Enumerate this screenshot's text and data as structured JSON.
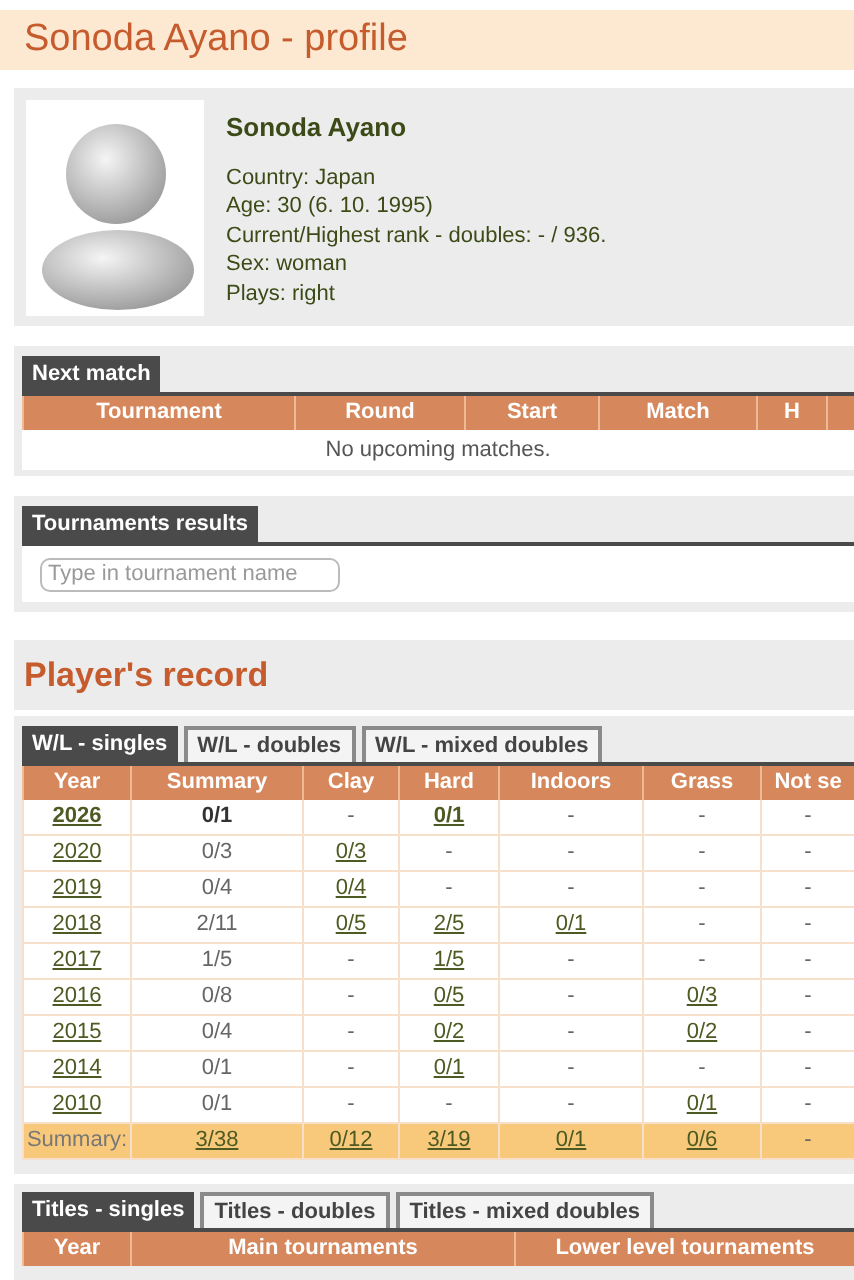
{
  "page_title": "Sonoda Ayano - profile",
  "profile": {
    "name": "Sonoda Ayano",
    "details": [
      "Country: Japan",
      "Age: 30 (6. 10. 1995)",
      "Current/Highest rank - doubles: - / 936.",
      "Sex: woman",
      "Plays: right"
    ]
  },
  "next_match": {
    "tab": "Next match",
    "columns": [
      "Tournament",
      "Round",
      "Start",
      "Match",
      "H"
    ],
    "empty_message": "No upcoming matches."
  },
  "tournament_results": {
    "tab": "Tournaments results",
    "search": {
      "placeholder": "Type in tournament name"
    }
  },
  "record_heading": "Player's record",
  "record": {
    "tabs": [
      {
        "label": "W/L - singles",
        "selected": true
      },
      {
        "label": "W/L - doubles",
        "selected": false
      },
      {
        "label": "W/L - mixed doubles",
        "selected": false
      }
    ],
    "columns": [
      "Year",
      "Summary",
      "Clay",
      "Hard",
      "Indoors",
      "Grass",
      "Not se"
    ],
    "rows": [
      {
        "current": true,
        "cells": [
          {
            "text": "2026",
            "link": true
          },
          {
            "text": "0/1",
            "link": false
          },
          {
            "text": "-",
            "link": false
          },
          {
            "text": "0/1",
            "link": true
          },
          {
            "text": "-",
            "link": false
          },
          {
            "text": "-",
            "link": false
          },
          {
            "text": "-",
            "link": false
          }
        ]
      },
      {
        "current": false,
        "cells": [
          {
            "text": "2020",
            "link": true
          },
          {
            "text": "0/3",
            "link": false
          },
          {
            "text": "0/3",
            "link": true
          },
          {
            "text": "-",
            "link": false
          },
          {
            "text": "-",
            "link": false
          },
          {
            "text": "-",
            "link": false
          },
          {
            "text": "-",
            "link": false
          }
        ]
      },
      {
        "current": false,
        "cells": [
          {
            "text": "2019",
            "link": true
          },
          {
            "text": "0/4",
            "link": false
          },
          {
            "text": "0/4",
            "link": true
          },
          {
            "text": "-",
            "link": false
          },
          {
            "text": "-",
            "link": false
          },
          {
            "text": "-",
            "link": false
          },
          {
            "text": "-",
            "link": false
          }
        ]
      },
      {
        "current": false,
        "cells": [
          {
            "text": "2018",
            "link": true
          },
          {
            "text": "2/11",
            "link": false
          },
          {
            "text": "0/5",
            "link": true
          },
          {
            "text": "2/5",
            "link": true
          },
          {
            "text": "0/1",
            "link": true
          },
          {
            "text": "-",
            "link": false
          },
          {
            "text": "-",
            "link": false
          }
        ]
      },
      {
        "current": false,
        "cells": [
          {
            "text": "2017",
            "link": true
          },
          {
            "text": "1/5",
            "link": false
          },
          {
            "text": "-",
            "link": false
          },
          {
            "text": "1/5",
            "link": true
          },
          {
            "text": "-",
            "link": false
          },
          {
            "text": "-",
            "link": false
          },
          {
            "text": "-",
            "link": false
          }
        ]
      },
      {
        "current": false,
        "cells": [
          {
            "text": "2016",
            "link": true
          },
          {
            "text": "0/8",
            "link": false
          },
          {
            "text": "-",
            "link": false
          },
          {
            "text": "0/5",
            "link": true
          },
          {
            "text": "-",
            "link": false
          },
          {
            "text": "0/3",
            "link": true
          },
          {
            "text": "-",
            "link": false
          }
        ]
      },
      {
        "current": false,
        "cells": [
          {
            "text": "2015",
            "link": true
          },
          {
            "text": "0/4",
            "link": false
          },
          {
            "text": "-",
            "link": false
          },
          {
            "text": "0/2",
            "link": true
          },
          {
            "text": "-",
            "link": false
          },
          {
            "text": "0/2",
            "link": true
          },
          {
            "text": "-",
            "link": false
          }
        ]
      },
      {
        "current": false,
        "cells": [
          {
            "text": "2014",
            "link": true
          },
          {
            "text": "0/1",
            "link": false
          },
          {
            "text": "-",
            "link": false
          },
          {
            "text": "0/1",
            "link": true
          },
          {
            "text": "-",
            "link": false
          },
          {
            "text": "-",
            "link": false
          },
          {
            "text": "-",
            "link": false
          }
        ]
      },
      {
        "current": false,
        "cells": [
          {
            "text": "2010",
            "link": true
          },
          {
            "text": "0/1",
            "link": false
          },
          {
            "text": "-",
            "link": false
          },
          {
            "text": "-",
            "link": false
          },
          {
            "text": "-",
            "link": false
          },
          {
            "text": "0/1",
            "link": true
          },
          {
            "text": "-",
            "link": false
          }
        ]
      }
    ],
    "summary": [
      {
        "text": "Summary:",
        "link": false
      },
      {
        "text": "3/38",
        "link": true
      },
      {
        "text": "0/12",
        "link": true
      },
      {
        "text": "3/19",
        "link": true
      },
      {
        "text": "0/1",
        "link": true
      },
      {
        "text": "0/6",
        "link": true
      },
      {
        "text": "-",
        "link": false
      }
    ]
  },
  "titles": {
    "tabs": [
      {
        "label": "Titles - singles",
        "selected": true
      },
      {
        "label": "Titles - doubles",
        "selected": false
      },
      {
        "label": "Titles - mixed doubles",
        "selected": false
      }
    ],
    "columns": [
      "Year",
      "Main tournaments",
      "Lower level tournaments"
    ]
  }
}
